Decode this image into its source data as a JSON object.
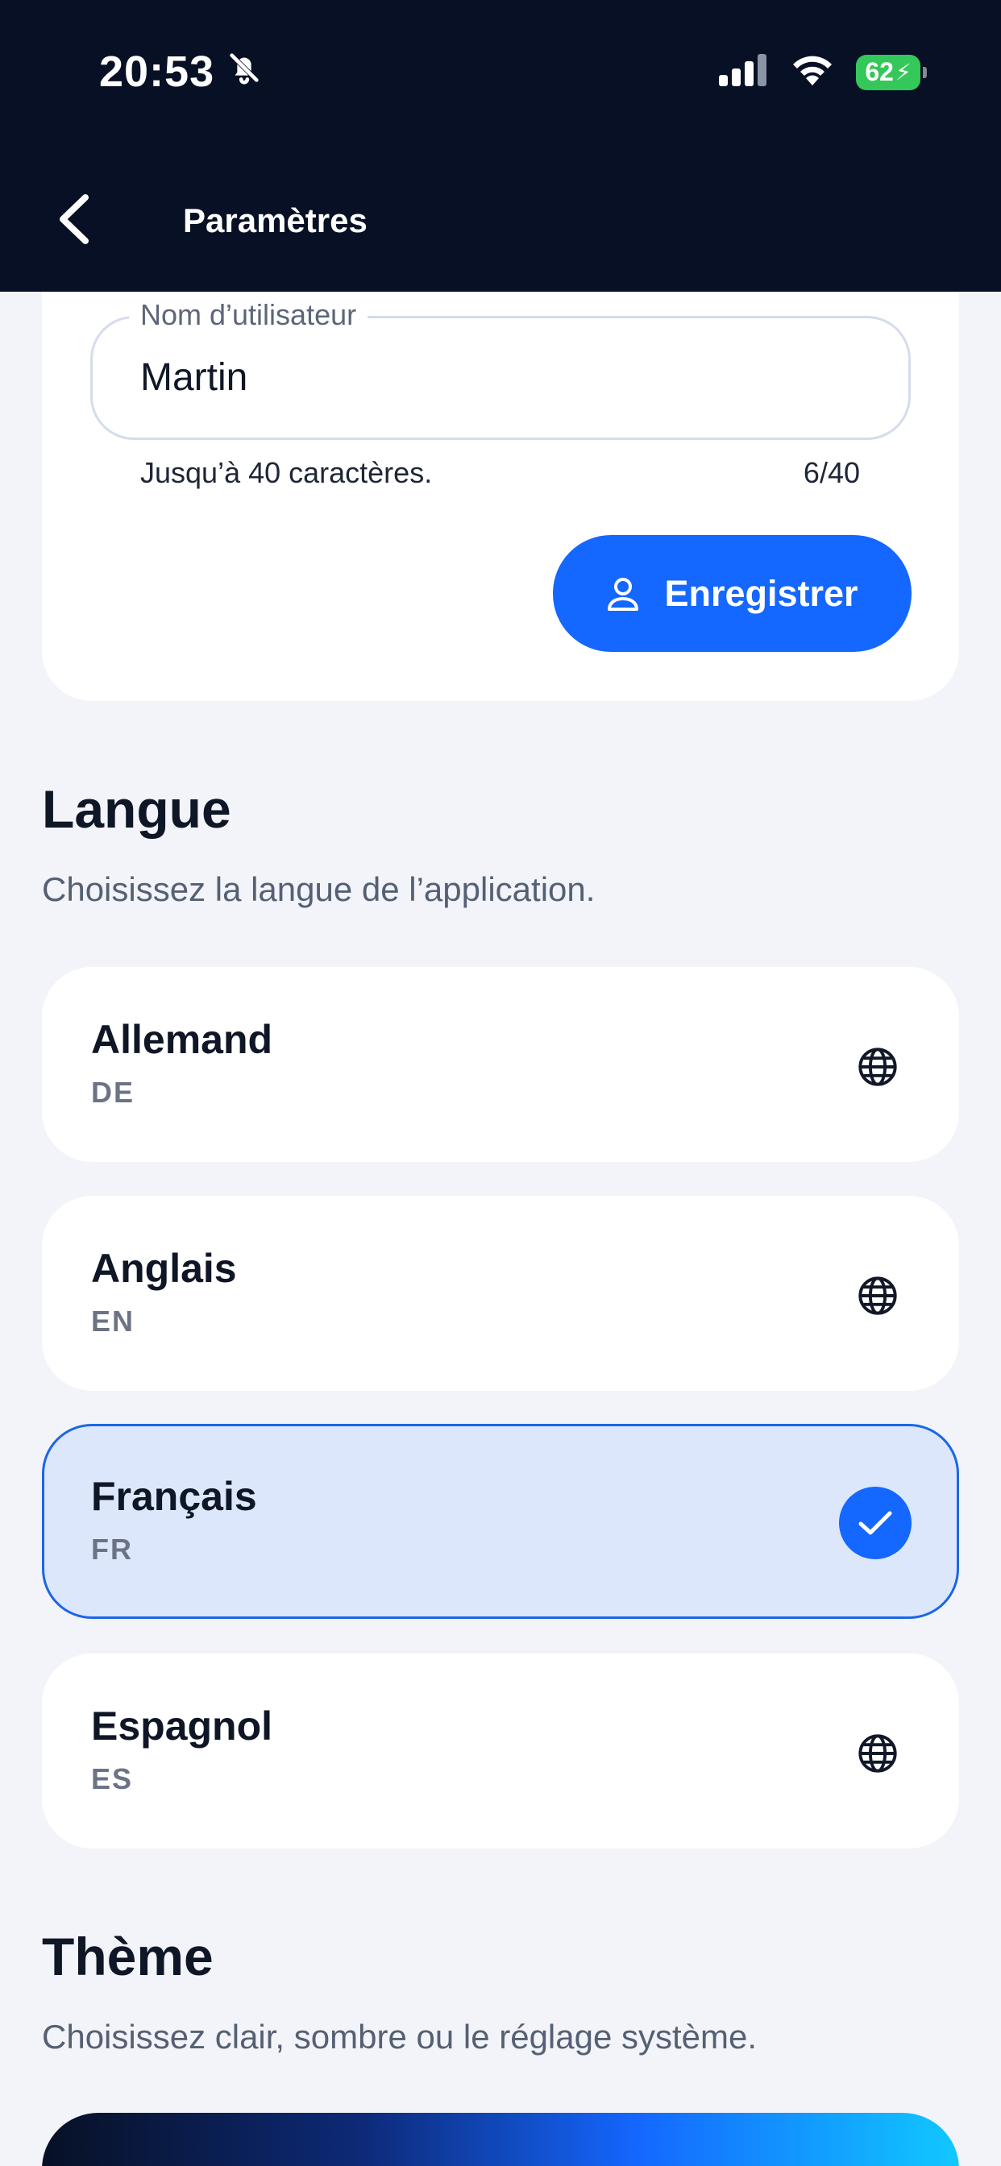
{
  "status_bar": {
    "time": "20:53",
    "battery": "62"
  },
  "nav": {
    "title": "Paramètres"
  },
  "username": {
    "label": "Nom d’utilisateur",
    "value": "Martin",
    "helper": "Jusqu’à 40 caractères.",
    "counter": "6/40",
    "save_label": "Enregistrer"
  },
  "language": {
    "title": "Langue",
    "subtitle": "Choisissez la langue de l’application.",
    "options": [
      {
        "name": "Allemand",
        "code": "DE",
        "selected": false
      },
      {
        "name": "Anglais",
        "code": "EN",
        "selected": false
      },
      {
        "name": "Français",
        "code": "FR",
        "selected": true
      },
      {
        "name": "Espagnol",
        "code": "ES",
        "selected": false
      }
    ]
  },
  "theme": {
    "title": "Thème",
    "subtitle": "Choisissez clair, sombre ou le réglage système."
  },
  "colors": {
    "nav_bg": "#071024",
    "accent": "#1467ff",
    "selected_bg": "#dce7fc",
    "page_bg": "#f2f4f9"
  }
}
